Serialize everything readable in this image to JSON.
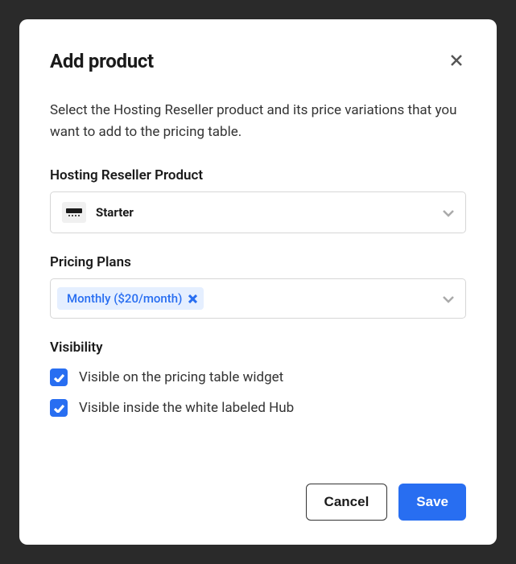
{
  "modal": {
    "title": "Add product",
    "description": "Select the Hosting Reseller product and its price variations that you want to add to the pricing table.",
    "product": {
      "label": "Hosting Reseller Product",
      "selected": "Starter"
    },
    "pricing_plans": {
      "label": "Pricing Plans",
      "chips": [
        {
          "label": "Monthly ($20/month)"
        }
      ]
    },
    "visibility": {
      "label": "Visibility",
      "options": [
        {
          "label": "Visible on the pricing table widget",
          "checked": true
        },
        {
          "label": "Visible inside the white labeled Hub",
          "checked": true
        }
      ]
    },
    "footer": {
      "cancel_label": "Cancel",
      "save_label": "Save"
    }
  }
}
